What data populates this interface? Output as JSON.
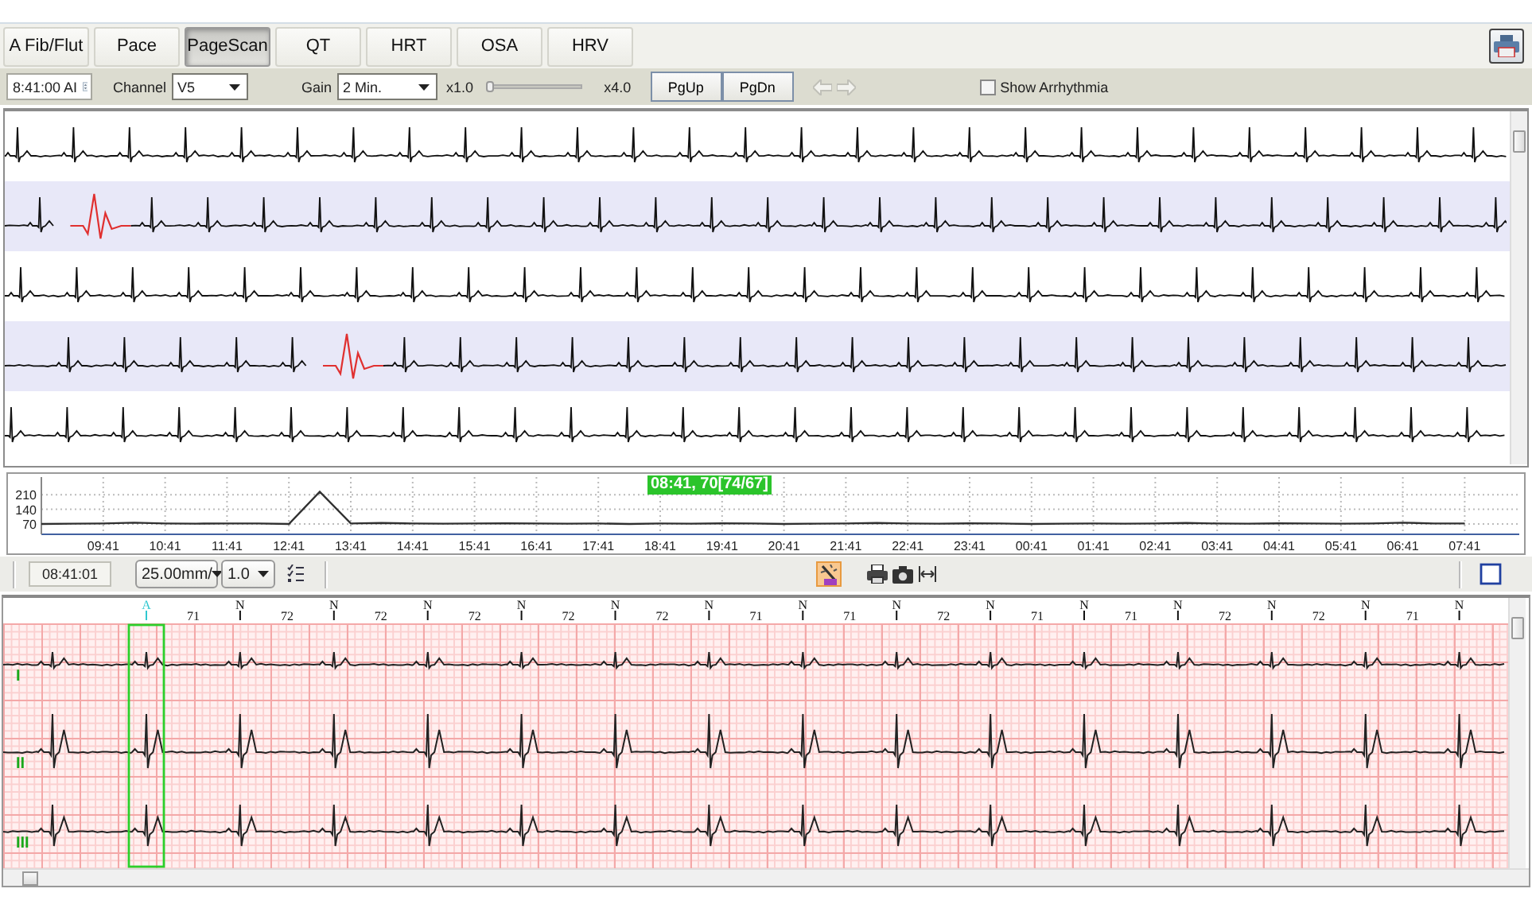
{
  "tabs": [
    {
      "label": "A Fib/Flut",
      "selected": false
    },
    {
      "label": "Pace",
      "selected": false
    },
    {
      "label": "PageScan",
      "selected": true
    },
    {
      "label": "QT",
      "selected": false
    },
    {
      "label": "HRT",
      "selected": false
    },
    {
      "label": "OSA",
      "selected": false
    },
    {
      "label": "HRV",
      "selected": false
    }
  ],
  "toolbar": {
    "time": "8:41:00 AI",
    "channel_label": "Channel",
    "channel": "V5",
    "gain_label": "Gain",
    "gain": "2 Min.",
    "zoom_min": "x1.0",
    "zoom": {
      "level": 0.02
    },
    "zoom_max": "x4.0",
    "buttons": [
      "PgUp",
      "PgDn"
    ],
    "nav_disabled": true,
    "show_arrhythmia": {
      "label": "Show Arrhythmia",
      "checked": false
    }
  },
  "page_scan": {
    "strips": [
      {
        "shaded": false,
        "flagged": false
      },
      {
        "shaded": true,
        "flagged": true
      },
      {
        "shaded": false,
        "flagged": false
      },
      {
        "shaded": true,
        "flagged": true
      },
      {
        "shaded": false,
        "flagged": false
      }
    ]
  },
  "trend": {
    "cursor_label": "08:41, 70[74/67]",
    "chart_data": {
      "type": "line",
      "categories": [
        null,
        null,
        "09:41",
        null,
        "10:41",
        null,
        "11:41",
        null,
        "12:41",
        null,
        "13:41",
        null,
        "14:41",
        null,
        "15:41",
        null,
        "16:41",
        null,
        "17:41",
        null,
        "18:41",
        null,
        "19:41",
        null,
        "20:41",
        null,
        "21:41",
        null,
        "22:41",
        null,
        "23:41",
        null,
        "00:41",
        null,
        "01:41",
        null,
        "02:41",
        null,
        "03:41",
        null,
        "04:41",
        null,
        "05:41",
        null,
        "06:41",
        null,
        "07:41"
      ],
      "series": [
        {
          "color": "#303030",
          "values": [
            70,
            71,
            72,
            76,
            72,
            71,
            72,
            72,
            70,
            225,
            72,
            74,
            72,
            71,
            72,
            73,
            72,
            71,
            72,
            70,
            72,
            71,
            73,
            72,
            70,
            71,
            72,
            74,
            72,
            71,
            73,
            72,
            70,
            71,
            72,
            71,
            72,
            74,
            72,
            71,
            73,
            72,
            71,
            72,
            76,
            72,
            72
          ]
        }
      ],
      "ylim": [
        20,
        280
      ],
      "yticks": [
        70,
        140,
        210
      ],
      "grid": true
    }
  },
  "strip_toolbar": {
    "time": "08:41:01",
    "speed": "25.00mm/",
    "gain": "1.0",
    "tools": [
      {
        "kind": "list",
        "selected": false
      },
      {
        "kind": "wand",
        "selected": true
      },
      {
        "kind": "printer",
        "selected": false
      },
      {
        "kind": "camera",
        "selected": false
      },
      {
        "kind": "fit",
        "selected": false
      },
      {
        "kind": "window",
        "selected": false
      }
    ]
  },
  "ecg_strip": {
    "beats": [
      {
        "label": "A",
        "selected": true
      },
      {
        "label": "N",
        "selected": false
      },
      {
        "label": "N",
        "selected": false
      },
      {
        "label": "N",
        "selected": false
      },
      {
        "label": "N",
        "selected": false
      },
      {
        "label": "N",
        "selected": false
      },
      {
        "label": "N",
        "selected": false
      },
      {
        "label": "N",
        "selected": false
      },
      {
        "label": "N",
        "selected": false
      },
      {
        "label": "N",
        "selected": false
      },
      {
        "label": "N",
        "selected": false
      },
      {
        "label": "N",
        "selected": false
      },
      {
        "label": "N",
        "selected": false
      },
      {
        "label": "N",
        "selected": false
      },
      {
        "label": "N",
        "selected": false
      }
    ],
    "rates": [
      "71",
      "72",
      "72",
      "72",
      "72",
      "72",
      "71",
      "71",
      "72",
      "71",
      "71",
      "72",
      "72",
      "71"
    ],
    "leads": [
      "I",
      "II",
      "III"
    ]
  }
}
